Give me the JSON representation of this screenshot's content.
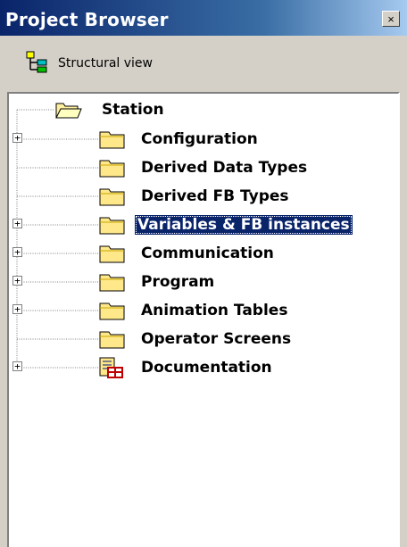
{
  "window": {
    "title": "Project Browser",
    "close_glyph": "×"
  },
  "view": {
    "label": "Structural view",
    "icon": "structural-view-icon"
  },
  "tree": {
    "root": {
      "label": "Station",
      "icon": "open-folder-icon"
    },
    "children": [
      {
        "label": "Configuration",
        "expandable": true,
        "icon": "folder-icon",
        "selected": false
      },
      {
        "label": "Derived Data Types",
        "expandable": false,
        "icon": "folder-icon",
        "selected": false
      },
      {
        "label": "Derived FB Types",
        "expandable": false,
        "icon": "folder-icon",
        "selected": false
      },
      {
        "label": "Variables & FB instances",
        "expandable": true,
        "icon": "folder-icon",
        "selected": true
      },
      {
        "label": "Communication",
        "expandable": true,
        "icon": "folder-icon",
        "selected": false
      },
      {
        "label": "Program",
        "expandable": true,
        "icon": "folder-icon",
        "selected": false
      },
      {
        "label": "Animation Tables",
        "expandable": true,
        "icon": "folder-icon",
        "selected": false
      },
      {
        "label": "Operator Screens",
        "expandable": false,
        "icon": "folder-icon",
        "selected": false
      },
      {
        "label": "Documentation",
        "expandable": true,
        "icon": "documentation-icon",
        "selected": false
      }
    ],
    "expander_glyph": "+"
  },
  "colors": {
    "title_bar": "#0a246a",
    "selection": "#0a246a",
    "folder": "#ffe88a"
  }
}
